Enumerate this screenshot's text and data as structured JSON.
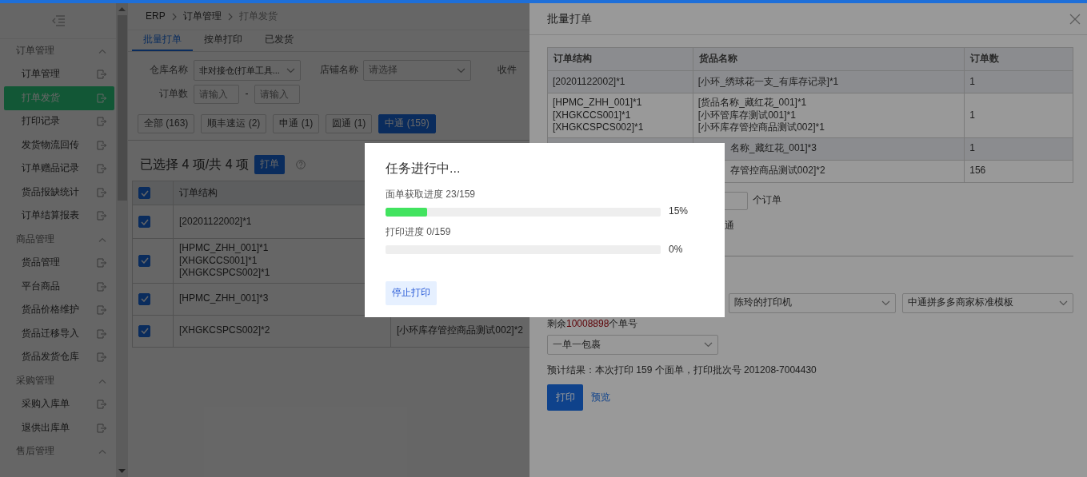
{
  "sidebar": {
    "groups": [
      {
        "label": "订单管理",
        "expanded": true,
        "items": [
          {
            "label": "订单管理",
            "selected": false
          },
          {
            "label": "打单发货",
            "selected": true
          },
          {
            "label": "打印记录",
            "selected": false
          },
          {
            "label": "发货物流回传",
            "selected": false
          },
          {
            "label": "订单赠品记录",
            "selected": false
          },
          {
            "label": "货品报缺统计",
            "selected": false
          },
          {
            "label": "订单结算报表",
            "selected": false
          }
        ]
      },
      {
        "label": "商品管理",
        "expanded": true,
        "items": [
          {
            "label": "货品管理",
            "selected": false
          },
          {
            "label": "平台商品",
            "selected": false
          },
          {
            "label": "货品价格维护",
            "selected": false
          },
          {
            "label": "货品迁移导入",
            "selected": false
          },
          {
            "label": "货品发货仓库",
            "selected": false
          }
        ]
      },
      {
        "label": "采购管理",
        "expanded": true,
        "items": [
          {
            "label": "采购入库单",
            "selected": false
          },
          {
            "label": "退供出库单",
            "selected": false
          }
        ]
      },
      {
        "label": "售后管理",
        "expanded": true
      }
    ]
  },
  "breadcrumb": [
    "ERP",
    "订单管理",
    "打单发货"
  ],
  "tabs": [
    {
      "label": "批量打单",
      "selected": true
    },
    {
      "label": "按单打印",
      "selected": false
    },
    {
      "label": "已发货",
      "selected": false
    }
  ],
  "filters": {
    "warehouse": {
      "label": "仓库名称",
      "value": "非对接仓(打单工具..."
    },
    "shop": {
      "label": "店铺名称",
      "placeholder": "请选择"
    },
    "recipient_label": "收件",
    "order_count": {
      "label": "订单数",
      "min_placeholder": "请输入",
      "separator": "-",
      "max_placeholder": "请输入"
    }
  },
  "carriers": [
    {
      "label": "全部 (163)",
      "selected": false
    },
    {
      "label": "顺丰速运 (2)",
      "selected": false
    },
    {
      "label": "申通 (1)",
      "selected": false
    },
    {
      "label": "圆通 (1)",
      "selected": false
    },
    {
      "label": "中通 (159)",
      "selected": true
    }
  ],
  "selection_summary": "已选择 4 项/共 4 项",
  "print_orders_button": "打单",
  "orders_table": {
    "all_checked": true,
    "columns": [
      "订单结构"
    ],
    "rows": [
      {
        "checked": true,
        "structure": [
          "[20201122002]*1"
        ]
      },
      {
        "checked": true,
        "structure": [
          "[HPMC_ZHH_001]*1",
          "[XHGKCCS001]*1",
          "[XHGKCSPCS002]*1"
        ]
      },
      {
        "checked": true,
        "structure": [
          "[HPMC_ZHH_001]*3"
        ]
      },
      {
        "checked": true,
        "structure": [
          "[XHGKCSPCS002]*2"
        ],
        "goods": [
          "[小环库存管控商品测试002]*2"
        ]
      }
    ]
  },
  "drawer": {
    "title": "批量打单",
    "table": {
      "columns": [
        "订单结构",
        "货品名称",
        "订单数"
      ],
      "rows": [
        {
          "structure": [
            "[20201122002]*1"
          ],
          "goods": [
            "[小环_绣球花一支_有库存记录]*1"
          ],
          "count": "1"
        },
        {
          "structure": [
            "[HPMC_ZHH_001]*1",
            "[XHGKCCS001]*1",
            "[XHGKCSPCS002]*1"
          ],
          "goods": [
            "[货品名称_藏红花_001]*1",
            "[小环管库存测试001]*1",
            "[小环库存管控商品测试002]*1"
          ],
          "count": "1"
        },
        {
          "goods": [
            "名称_藏红花_001]*3"
          ],
          "count": "1"
        },
        {
          "goods": [
            "存管控商品测试002]*2"
          ],
          "count": "156"
        }
      ]
    },
    "order_unit": "个订单",
    "carrier_fragment": "通",
    "printer": "陈玲的打印机",
    "template": "中通拼多多商家标准模板",
    "remaining": {
      "prefix": "剩余",
      "number": "10008898",
      "suffix": "个单号"
    },
    "package_mode": "一单一包裹",
    "estimate": "预计结果：本次打印 159 个面单，打印批次号 201208-7004430",
    "print_button": "打印",
    "preview_link": "预览"
  },
  "modal": {
    "title": "任务进行中...",
    "progress": [
      {
        "label": "面单获取进度 23/159",
        "level": 0.15,
        "reading": "15%"
      },
      {
        "label": "打印进度 0/159",
        "level": 0,
        "reading": "0%"
      }
    ],
    "stop_button": "停止打印"
  }
}
